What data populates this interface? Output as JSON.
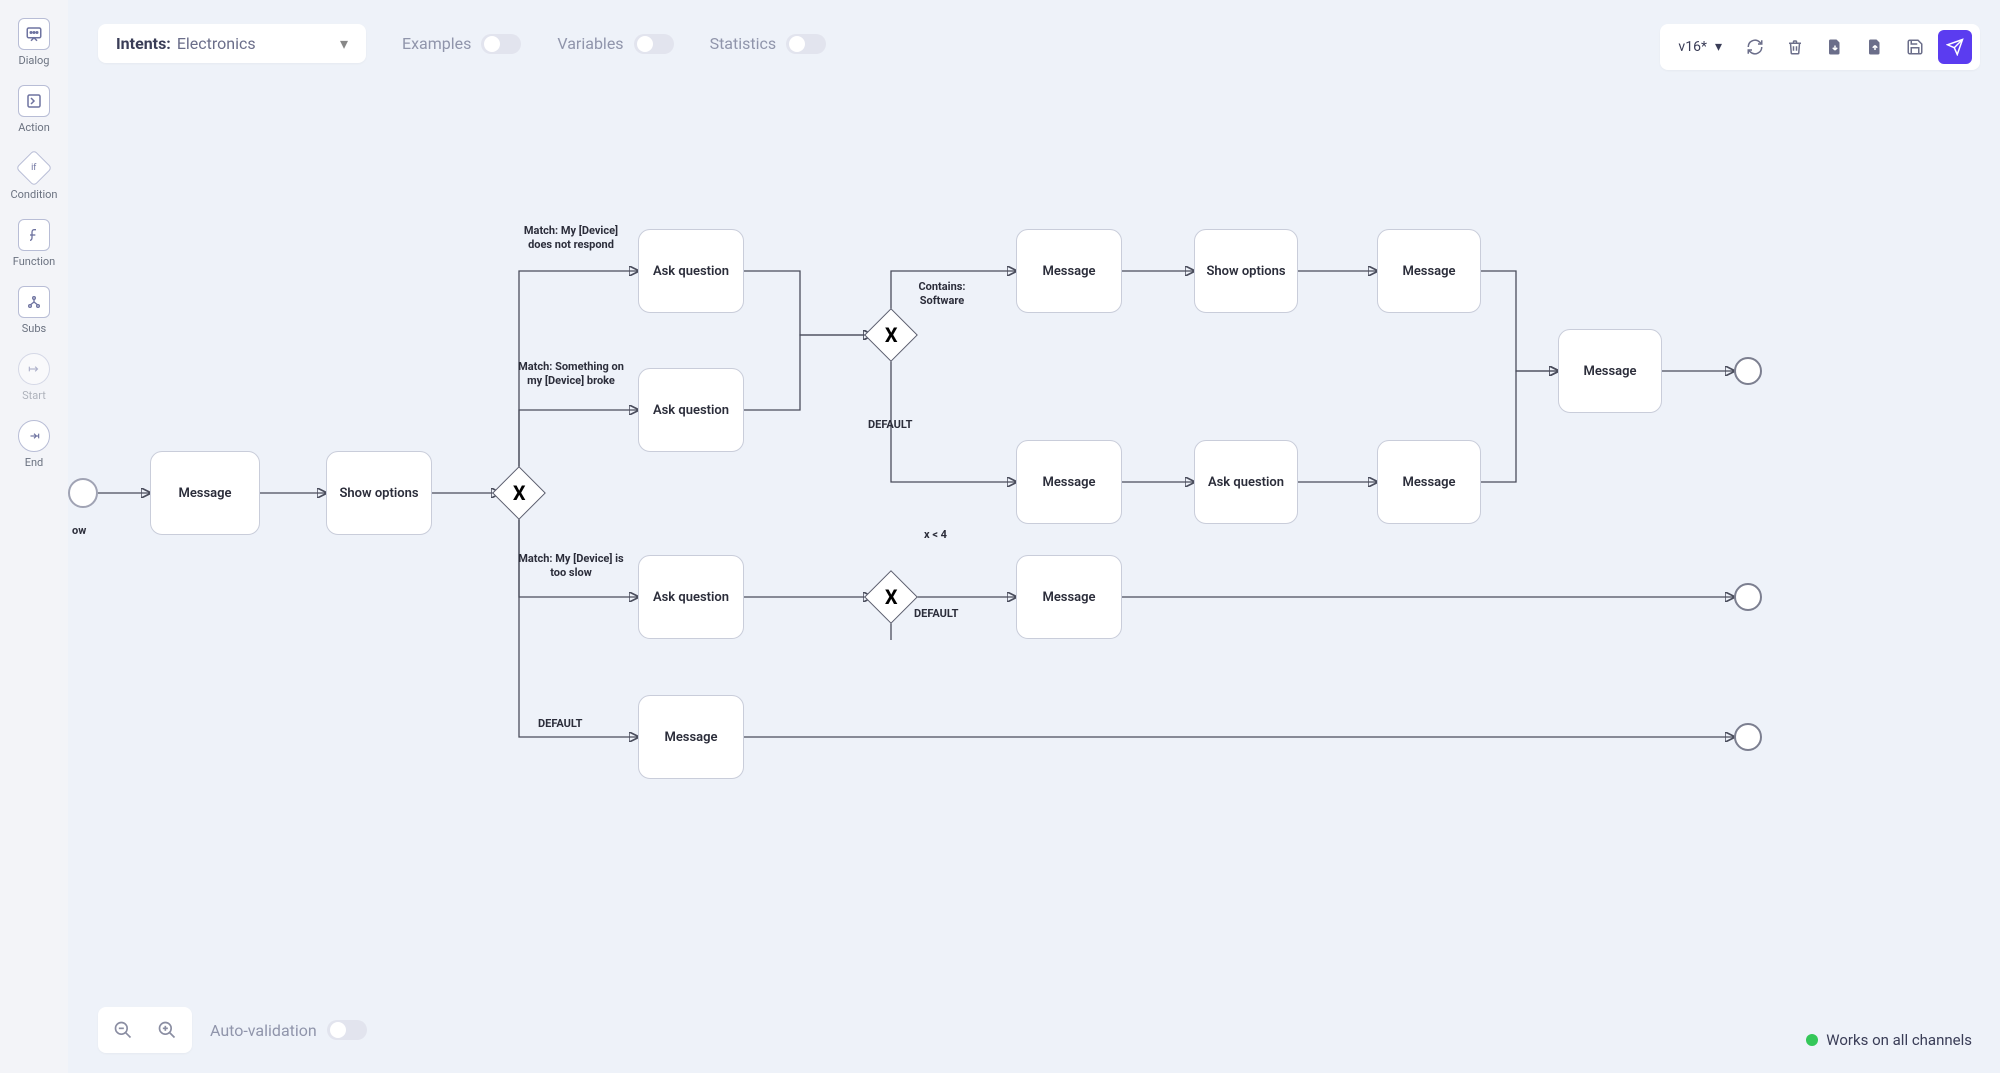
{
  "sidebar": {
    "items": [
      {
        "label": "Dialog"
      },
      {
        "label": "Action"
      },
      {
        "label": "Condition"
      },
      {
        "label": "Function"
      },
      {
        "label": "Subs"
      },
      {
        "label": "Start"
      },
      {
        "label": "End"
      }
    ]
  },
  "header": {
    "intents_prefix": "Intents:",
    "intents_name": "Electronics",
    "toggles": [
      {
        "label": "Examples"
      },
      {
        "label": "Variables"
      },
      {
        "label": "Statistics"
      }
    ],
    "version": "v16*"
  },
  "flow": {
    "start_label": "ow",
    "nodes": {
      "n_message_1": "Message",
      "n_show_options_1": "Show options",
      "n_ask_1": "Ask question",
      "n_ask_2": "Ask question",
      "n_ask_3": "Ask question",
      "n_message_default": "Message",
      "n_msg_top_1": "Message",
      "n_show_opt_2": "Show options",
      "n_msg_top_2": "Message",
      "n_msg_mid_1": "Message",
      "n_ask_mid": "Ask question",
      "n_msg_mid_2": "Message",
      "n_msg_slow": "Message",
      "n_msg_final": "Message"
    },
    "gateway_label": "X",
    "edge_labels": {
      "e_match_not_respond": "Match: My [Device] does not respond",
      "e_match_broke": "Match: Something on my [Device] broke",
      "e_match_slow": "Match: My [Device] is too slow",
      "e_default_1": "DEFAULT",
      "e_contains_software": "Contains: Software",
      "e_default_2": "DEFAULT",
      "e_xlt4": "x < 4",
      "e_default_3": "DEFAULT"
    }
  },
  "footer": {
    "auto_validation": "Auto-validation",
    "channels": "Works on all channels"
  },
  "colors": {
    "primary": "#5b3cf0",
    "ok": "#34c759"
  }
}
